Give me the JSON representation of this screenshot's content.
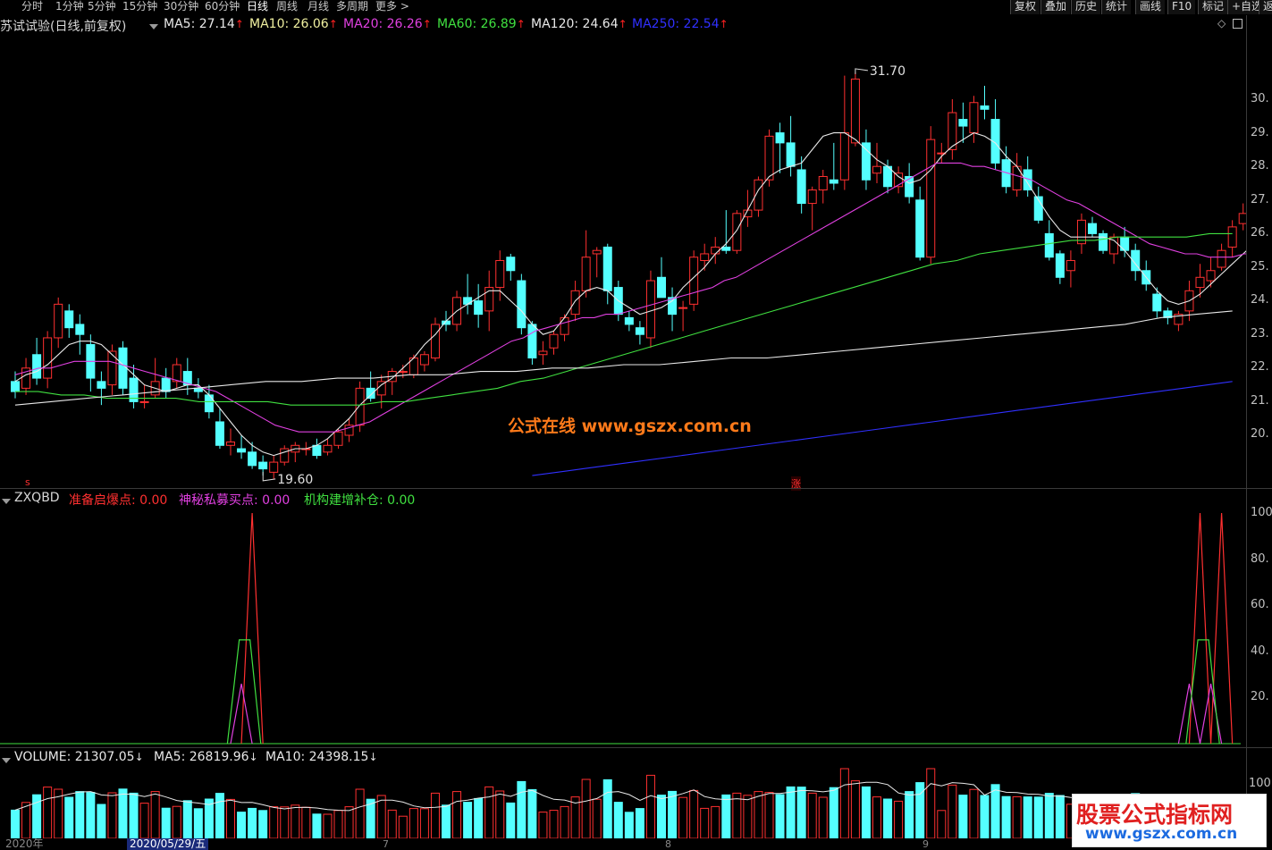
{
  "toolbar": {
    "periods": [
      "分时",
      "1分钟",
      "5分钟",
      "15分钟",
      "30分钟",
      "60分钟",
      "日线",
      "周线",
      "月线",
      "多周期",
      "更多 >"
    ],
    "active_period": "日线",
    "right_buttons": [
      "复权",
      "叠加",
      "历史",
      "统计",
      "画线",
      "F10",
      "标记",
      "+自选",
      "返"
    ]
  },
  "stock": {
    "title": "苏试试验(日线,前复权)"
  },
  "ma_header": {
    "items": [
      {
        "label": "MA5: 27.14",
        "color": "#e8e8e8",
        "arrow": "up"
      },
      {
        "label": "MA10: 26.06",
        "color": "#f0f0a0",
        "arrow": "up"
      },
      {
        "label": "MA20: 26.26",
        "color": "#e040e0",
        "arrow": "up"
      },
      {
        "label": "MA60: 26.89",
        "color": "#40e040",
        "arrow": "up"
      },
      {
        "label": "MA120: 24.64",
        "color": "#e8e8e8",
        "arrow": "up"
      },
      {
        "label": "MA250: 22.54",
        "color": "#3030ff",
        "arrow": "up"
      }
    ],
    "up_arrow": "↑",
    "down_arrow": "↓"
  },
  "price_axis": [
    "30.",
    "29.",
    "28.",
    "27.",
    "26.",
    "25.",
    "24.",
    "23.",
    "22.",
    "21.",
    "20."
  ],
  "annotations": {
    "high": "31.70",
    "low": "19.60",
    "rise_marker": "涨",
    "s_marker": "s"
  },
  "indicator": {
    "name": "ZXQBD",
    "items": [
      {
        "label": "准备启爆点: 0.00",
        "color": "#ff3030"
      },
      {
        "label": "神秘私募买点: 0.00",
        "color": "#e040e0"
      },
      {
        "label": "机构建增补仓: 0.00",
        "color": "#40e040"
      }
    ],
    "axis": [
      "100",
      "80.",
      "60.",
      "40.",
      "20."
    ]
  },
  "volume": {
    "items": [
      {
        "label": "VOLUME: 21307.05",
        "color": "#e8e8e8",
        "arrow": "down"
      },
      {
        "label": "MA5: 26819.96",
        "color": "#e8e8e8",
        "arrow": "down"
      },
      {
        "label": "MA10: 24398.15",
        "color": "#e8e8e8",
        "arrow": "down"
      }
    ],
    "axis": [
      "100"
    ]
  },
  "time_axis": {
    "year_label": "2020年",
    "selected_date": "2020/05/29/五",
    "month_marks": [
      "7",
      "8",
      "9"
    ]
  },
  "watermarks": {
    "center": "公式在线  www.gszx.com.cn",
    "corner_title": "股票公式指标网",
    "corner_url": "www.gszx.com.cn"
  },
  "colors": {
    "up": "#ff3030",
    "down": "#54ffff",
    "ma5": "#e8e8e8",
    "ma10": "#f0f0a0",
    "ma20": "#e040e0",
    "ma60": "#40e040",
    "ma120": "#e8e8e8",
    "ma250": "#3030ff"
  },
  "chart_data": {
    "type": "candlestick",
    "price_range": [
      19.6,
      31.7
    ],
    "candles": [
      [
        22.5,
        22.8,
        22.0,
        22.2
      ],
      [
        22.3,
        23.2,
        22.1,
        22.9
      ],
      [
        23.3,
        23.8,
        22.4,
        22.6
      ],
      [
        22.6,
        24.0,
        22.3,
        23.8
      ],
      [
        23.8,
        25.0,
        23.5,
        24.8
      ],
      [
        24.6,
        24.8,
        23.8,
        24.1
      ],
      [
        24.2,
        24.5,
        23.3,
        23.9
      ],
      [
        23.6,
        23.9,
        22.2,
        22.6
      ],
      [
        22.5,
        22.8,
        21.8,
        22.3
      ],
      [
        22.4,
        23.6,
        22.1,
        23.4
      ],
      [
        23.5,
        23.7,
        22.1,
        22.3
      ],
      [
        22.6,
        23.0,
        21.7,
        21.9
      ],
      [
        21.9,
        22.4,
        21.7,
        21.9
      ],
      [
        22.1,
        23.2,
        22.0,
        22.5
      ],
      [
        22.6,
        22.9,
        22.0,
        22.2
      ],
      [
        22.5,
        23.2,
        22.3,
        23.0
      ],
      [
        22.8,
        23.2,
        22.1,
        22.4
      ],
      [
        22.3,
        22.6,
        22.0,
        22.2
      ],
      [
        22.1,
        22.4,
        21.4,
        21.6
      ],
      [
        21.3,
        21.7,
        20.5,
        20.6
      ],
      [
        20.6,
        21.1,
        20.3,
        20.7
      ],
      [
        20.5,
        20.9,
        20.2,
        20.4
      ],
      [
        20.4,
        20.7,
        19.9,
        20.0
      ],
      [
        20.1,
        20.3,
        19.7,
        19.9
      ],
      [
        19.8,
        20.3,
        19.6,
        20.1
      ],
      [
        20.1,
        20.6,
        20.0,
        20.5
      ],
      [
        20.4,
        20.7,
        20.1,
        20.6
      ],
      [
        20.5,
        20.7,
        20.3,
        20.5
      ],
      [
        20.6,
        20.8,
        20.2,
        20.3
      ],
      [
        20.4,
        20.8,
        20.3,
        20.6
      ],
      [
        20.6,
        21.1,
        20.5,
        21.0
      ],
      [
        20.9,
        21.4,
        20.7,
        21.2
      ],
      [
        21.2,
        22.5,
        21.0,
        22.3
      ],
      [
        22.3,
        22.8,
        21.9,
        22.0
      ],
      [
        22.1,
        22.7,
        21.7,
        22.5
      ],
      [
        22.5,
        22.9,
        22.1,
        22.8
      ],
      [
        22.8,
        23.0,
        22.6,
        22.8
      ],
      [
        22.7,
        23.3,
        22.6,
        23.2
      ],
      [
        23.0,
        23.4,
        22.8,
        23.3
      ],
      [
        23.2,
        24.4,
        23.1,
        24.2
      ],
      [
        24.3,
        24.6,
        24.0,
        24.2
      ],
      [
        24.2,
        25.2,
        24.0,
        25.0
      ],
      [
        25.0,
        25.7,
        24.5,
        24.8
      ],
      [
        24.9,
        25.4,
        24.1,
        24.5
      ],
      [
        24.6,
        25.8,
        24.0,
        25.3
      ],
      [
        25.3,
        26.4,
        24.9,
        26.1
      ],
      [
        26.2,
        26.3,
        25.5,
        25.8
      ],
      [
        25.5,
        25.7,
        23.9,
        24.1
      ],
      [
        24.2,
        24.3,
        23.0,
        23.2
      ],
      [
        23.3,
        23.7,
        23.0,
        23.4
      ],
      [
        23.5,
        24.0,
        23.3,
        23.9
      ],
      [
        23.9,
        24.5,
        23.7,
        24.4
      ],
      [
        24.5,
        25.5,
        24.3,
        25.2
      ],
      [
        25.2,
        27.0,
        25.0,
        26.2
      ],
      [
        26.3,
        26.5,
        25.6,
        26.4
      ],
      [
        26.5,
        26.6,
        24.8,
        25.2
      ],
      [
        25.3,
        25.5,
        24.3,
        24.5
      ],
      [
        24.4,
        24.6,
        24.0,
        24.2
      ],
      [
        24.1,
        24.3,
        23.6,
        23.9
      ],
      [
        23.8,
        25.8,
        23.5,
        25.5
      ],
      [
        25.6,
        26.2,
        25.0,
        25.0
      ],
      [
        25.0,
        25.3,
        24.0,
        24.5
      ],
      [
        24.7,
        24.9,
        24.0,
        24.7
      ],
      [
        24.8,
        26.4,
        24.6,
        26.2
      ],
      [
        26.1,
        26.6,
        25.8,
        26.3
      ],
      [
        26.3,
        26.8,
        26.0,
        26.5
      ],
      [
        26.5,
        27.6,
        26.3,
        26.4
      ],
      [
        26.4,
        27.6,
        26.3,
        27.5
      ],
      [
        27.4,
        28.2,
        27.1,
        27.6
      ],
      [
        27.6,
        28.6,
        27.4,
        28.5
      ],
      [
        28.5,
        30.0,
        28.3,
        29.8
      ],
      [
        29.9,
        30.2,
        28.7,
        29.6
      ],
      [
        29.6,
        30.4,
        28.6,
        28.9
      ],
      [
        28.8,
        29.2,
        27.5,
        27.8
      ],
      [
        27.8,
        28.3,
        27.0,
        28.2
      ],
      [
        28.2,
        28.8,
        27.8,
        28.6
      ],
      [
        28.5,
        29.6,
        28.2,
        28.4
      ],
      [
        28.5,
        31.6,
        28.2,
        29.9
      ],
      [
        29.6,
        31.7,
        29.5,
        31.5
      ],
      [
        29.6,
        30.0,
        28.2,
        28.5
      ],
      [
        28.7,
        29.6,
        28.4,
        28.9
      ],
      [
        28.9,
        29.1,
        28.1,
        28.3
      ],
      [
        28.3,
        28.9,
        28.1,
        28.7
      ],
      [
        28.6,
        29.0,
        27.8,
        28.0
      ],
      [
        27.9,
        28.3,
        26.1,
        26.2
      ],
      [
        26.2,
        30.1,
        26.0,
        29.7
      ],
      [
        29.3,
        29.6,
        29.0,
        29.3
      ],
      [
        29.4,
        30.9,
        29.1,
        30.5
      ],
      [
        30.3,
        30.8,
        29.6,
        30.1
      ],
      [
        29.9,
        31.0,
        29.6,
        30.8
      ],
      [
        30.7,
        31.3,
        30.3,
        30.6
      ],
      [
        30.3,
        30.9,
        28.8,
        29.0
      ],
      [
        29.1,
        29.5,
        28.1,
        28.3
      ],
      [
        28.2,
        29.3,
        28.0,
        28.9
      ],
      [
        28.8,
        29.2,
        28.0,
        28.2
      ],
      [
        28.0,
        28.3,
        27.2,
        27.3
      ],
      [
        26.9,
        27.3,
        26.1,
        26.2
      ],
      [
        26.3,
        26.4,
        25.4,
        25.6
      ],
      [
        25.8,
        26.4,
        25.3,
        26.1
      ],
      [
        26.6,
        27.5,
        26.3,
        27.3
      ],
      [
        27.2,
        27.4,
        26.8,
        26.9
      ],
      [
        26.9,
        27.0,
        26.3,
        26.4
      ],
      [
        26.3,
        26.9,
        26.0,
        26.8
      ],
      [
        26.8,
        27.1,
        26.2,
        26.4
      ],
      [
        26.4,
        26.6,
        25.5,
        25.8
      ],
      [
        25.8,
        26.1,
        25.2,
        25.4
      ],
      [
        25.1,
        25.3,
        24.4,
        24.6
      ],
      [
        24.6,
        24.7,
        24.2,
        24.4
      ],
      [
        24.2,
        24.6,
        24.0,
        24.5
      ],
      [
        24.6,
        25.5,
        24.3,
        25.2
      ],
      [
        25.3,
        26.0,
        25.0,
        25.6
      ],
      [
        25.5,
        26.2,
        25.3,
        25.8
      ],
      [
        25.9,
        26.6,
        25.8,
        26.4
      ],
      [
        26.5,
        27.3,
        26.2,
        27.1
      ],
      [
        27.2,
        27.8,
        27.0,
        27.5
      ],
      [
        27.5,
        28.2,
        27.2,
        27.4
      ],
      [
        27.3,
        27.7,
        27.1,
        27.1
      ]
    ],
    "ma_series": {
      "MA5": [
        22.5,
        22.7,
        22.8,
        23.0,
        23.3,
        23.6,
        23.7,
        23.7,
        23.6,
        23.3,
        23.0,
        22.7,
        22.4,
        22.3,
        22.2,
        22.3,
        22.4,
        22.4,
        22.1,
        21.7,
        21.3,
        20.9,
        20.6,
        20.4,
        20.3,
        20.4,
        20.5,
        20.5,
        20.6,
        20.8,
        21.1,
        21.4,
        21.8,
        22.1,
        22.4,
        22.6,
        22.9,
        23.2,
        23.6,
        23.9,
        24.3,
        24.6,
        24.8,
        25.0,
        25.2,
        25.2,
        24.9,
        24.6,
        24.2,
        23.9,
        24.0,
        24.4,
        24.9,
        25.2,
        25.3,
        25.2,
        24.9,
        24.7,
        24.5,
        24.6,
        24.7,
        24.9,
        25.3,
        25.6,
        25.9,
        26.3,
        26.6,
        27.0,
        27.6,
        28.2,
        28.6,
        28.8,
        28.9,
        29.0,
        29.4,
        29.8,
        29.9,
        29.9,
        29.7,
        29.4,
        29.1,
        28.9,
        28.6,
        28.4,
        28.5,
        28.8,
        29.2,
        29.5,
        29.7,
        29.9,
        29.8,
        29.6,
        29.2,
        28.9,
        28.4,
        27.9,
        27.4,
        27.0,
        26.8,
        26.8,
        26.8,
        26.8,
        26.7,
        26.4,
        26.0,
        25.6,
        25.2,
        24.9,
        24.8,
        24.9,
        25.1,
        25.4,
        25.7,
        26.0,
        26.3,
        26.6,
        27.0
      ],
      "MA20": [
        22.7,
        22.8,
        22.9,
        22.9,
        23.0,
        23.1,
        23.1,
        23.1,
        23.1,
        23.0,
        22.9,
        22.8,
        22.7,
        22.6,
        22.5,
        22.4,
        22.3,
        22.2,
        22.0,
        21.8,
        21.6,
        21.4,
        21.2,
        21.1,
        21.0,
        21.0,
        21.0,
        21.0,
        21.1,
        21.2,
        21.3,
        21.5,
        21.7,
        21.9,
        22.1,
        22.3,
        22.5,
        22.7,
        22.9,
        23.1,
        23.3,
        23.5,
        23.7,
        23.8,
        24.0,
        24.1,
        24.2,
        24.3,
        24.4,
        24.4,
        24.5,
        24.5,
        24.6,
        24.7,
        24.8,
        24.9,
        25.0,
        25.1,
        25.2,
        25.3,
        25.5,
        25.6,
        25.8,
        26.0,
        26.2,
        26.4,
        26.6,
        26.8,
        27.0,
        27.2,
        27.4,
        27.6,
        27.8,
        28.0,
        28.2,
        28.4,
        28.6,
        28.8,
        29.0,
        29.0,
        29.0,
        28.9,
        28.9,
        28.8,
        28.7,
        28.6,
        28.5,
        28.3,
        28.1,
        27.9,
        27.8,
        27.6,
        27.4,
        27.2,
        27.0,
        26.8,
        26.6,
        26.5,
        26.4,
        26.3,
        26.3,
        26.2,
        26.2,
        26.2,
        26.3,
        26.3
      ],
      "MA60": [
        22.2,
        22.2,
        22.1,
        22.1,
        22.0,
        22.0,
        22.0,
        22.0,
        21.9,
        21.9,
        21.9,
        21.9,
        21.8,
        21.8,
        21.8,
        21.8,
        21.9,
        21.9,
        22.0,
        22.1,
        22.2,
        22.3,
        22.5,
        22.6,
        22.8,
        23.0,
        23.2,
        23.4,
        23.6,
        23.8,
        24.0,
        24.2,
        24.4,
        24.6,
        24.8,
        25.0,
        25.2,
        25.4,
        25.6,
        25.8,
        26.0,
        26.1,
        26.3,
        26.4,
        26.5,
        26.6,
        26.7,
        26.7,
        26.8,
        26.8,
        26.8,
        26.8,
        26.9,
        26.9
      ],
      "MA120": [
        21.8,
        21.9,
        22.0,
        22.1,
        22.2,
        22.3,
        22.4,
        22.5,
        22.5,
        22.6,
        22.6,
        22.7,
        22.7,
        22.8,
        22.8,
        22.9,
        22.9,
        23.0,
        23.0,
        23.1,
        23.2,
        23.2,
        23.3,
        23.4,
        23.5,
        23.6,
        23.7,
        23.8,
        23.9,
        24.0,
        24.1,
        24.2,
        24.4,
        24.5,
        24.6
      ],
      "MA250": [
        19.7,
        19.9,
        20.1,
        20.3,
        20.5,
        20.7,
        20.9,
        21.1,
        21.3,
        21.5,
        21.7,
        21.9,
        22.1,
        22.3,
        22.5
      ]
    },
    "indicator_series": {
      "准备启爆点": {
        "peaks": [
          {
            "index": 22,
            "value": 100
          },
          {
            "index": 110,
            "value": 100
          },
          {
            "index": 112,
            "value": 100
          }
        ]
      },
      "神秘私募买点": {
        "peaks": [
          {
            "index": 21,
            "value": 26
          },
          {
            "index": 109,
            "value": 26
          },
          {
            "index": 111,
            "value": 26
          }
        ]
      },
      "机构建增补仓": {
        "peaks": [
          {
            "index": 21,
            "value": 45
          },
          {
            "index": 110,
            "value": 45
          }
        ]
      }
    },
    "volume_range": [
      0,
      100000
    ]
  }
}
